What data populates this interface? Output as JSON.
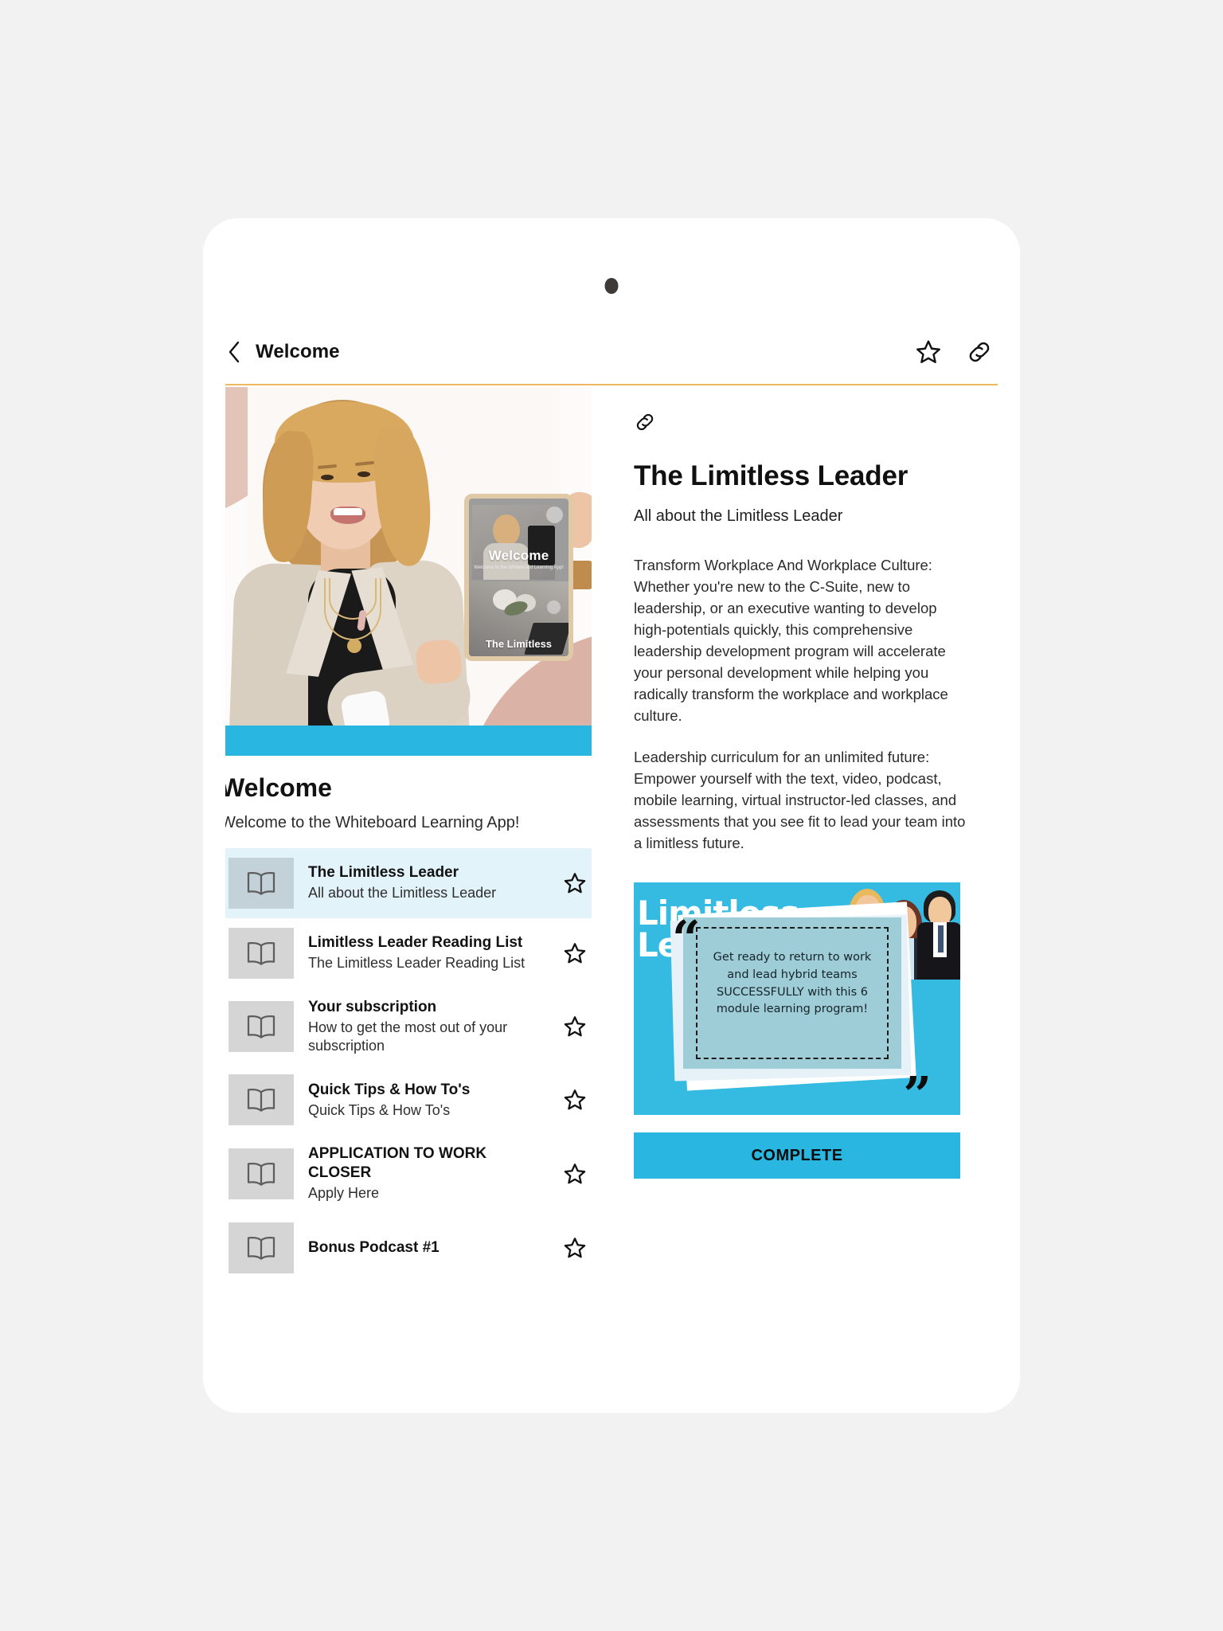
{
  "header": {
    "back_icon": "chevron-left-icon",
    "title": "Welcome",
    "star_icon": "star-outline-icon",
    "link_icon": "link-icon"
  },
  "hero": {
    "mini_tablet_welcome": "Welcome",
    "mini_tablet_sub": "Welcome to the Whiteboard Learning App!",
    "mini_tablet_limitless": "The Limitless",
    "accent_band_color": "#29b6e0"
  },
  "left": {
    "welcome_title": "Welcome",
    "welcome_sub": "Welcome to the Whiteboard Learning App!",
    "lessons": [
      {
        "title": "The Limitless Leader",
        "desc": "All about the Limitless Leader",
        "icon": "book-icon",
        "star": "star-outline-icon",
        "active": true
      },
      {
        "title": "Limitless Leader Reading List",
        "desc": "The Limitless Leader Reading List",
        "icon": "book-icon",
        "star": "star-outline-icon",
        "active": false
      },
      {
        "title": "Your subscription",
        "desc": "How to get the most out of your subscription",
        "icon": "book-icon",
        "star": "star-outline-icon",
        "active": false
      },
      {
        "title": "Quick Tips & How To's",
        "desc": "Quick Tips & How To's",
        "icon": "book-icon",
        "star": "star-outline-icon",
        "active": false
      },
      {
        "title": "APPLICATION TO WORK CLOSER",
        "desc": "Apply Here",
        "icon": "book-icon",
        "star": "star-outline-icon",
        "active": false
      },
      {
        "title": "Bonus Podcast #1",
        "desc": "",
        "icon": "book-icon",
        "star": "star-outline-icon",
        "active": false
      }
    ]
  },
  "detail": {
    "link_icon": "link-icon",
    "title": "The Limitless Leader",
    "subtitle": "All about the Limitless Leader",
    "paragraph1": "Transform Workplace And Workplace Culture: Whether you're new to the C-Suite, new to leadership, or an executive wanting to develop high-potentials quickly, this comprehensive leadership development program will accelerate your personal development while helping you radically transform the workplace and workplace culture.",
    "paragraph2": "Leadership curriculum for an unlimited future: Empower yourself with the text, video, podcast, mobile learning, virtual instructor-led classes, and assessments that you see fit to lead your team into a limitless future.",
    "promo": {
      "word1": "Limitless",
      "word2": "Leadership",
      "quote_open": "“",
      "quote_close": "”",
      "quote_text": "Get ready to return to work and lead hybrid teams SUCCESSFULLY with this 6 module learning program!",
      "bg_color": "#35bae2"
    },
    "complete_label": "COMPLETE"
  }
}
